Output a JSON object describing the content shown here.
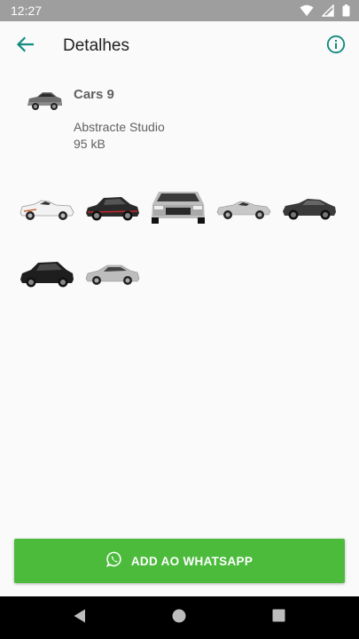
{
  "status_bar": {
    "time": "12:27",
    "icons": [
      "wifi-icon",
      "signal-icon",
      "battery-icon"
    ]
  },
  "toolbar": {
    "title": "Detalhes",
    "back_icon": "arrow-back-icon",
    "info_icon": "info-icon",
    "accent_color": "#128c7e"
  },
  "pack": {
    "name": "Cars 9",
    "publisher": "Abstracte Studio",
    "size": "95 kB"
  },
  "stickers": [
    {
      "name": "white-convertible",
      "color": "#f0f0f0"
    },
    {
      "name": "black-red-hatchback",
      "color": "#2a2a2a"
    },
    {
      "name": "silver-mustang-front",
      "color": "#b8b8b8"
    },
    {
      "name": "silver-convertible",
      "color": "#c9c9c9"
    },
    {
      "name": "dark-mustang",
      "color": "#3c3c3c"
    },
    {
      "name": "black-hatchback",
      "color": "#1e1e1e"
    },
    {
      "name": "silver-sedan",
      "color": "#bdbdbd"
    }
  ],
  "add_button": {
    "label": "ADD AO WHATSAPP",
    "color": "#4cbb3c",
    "icon": "whatsapp-icon"
  },
  "nav_bar": {
    "icons": [
      "back-triangle-icon",
      "home-circle-icon",
      "recents-square-icon"
    ]
  }
}
